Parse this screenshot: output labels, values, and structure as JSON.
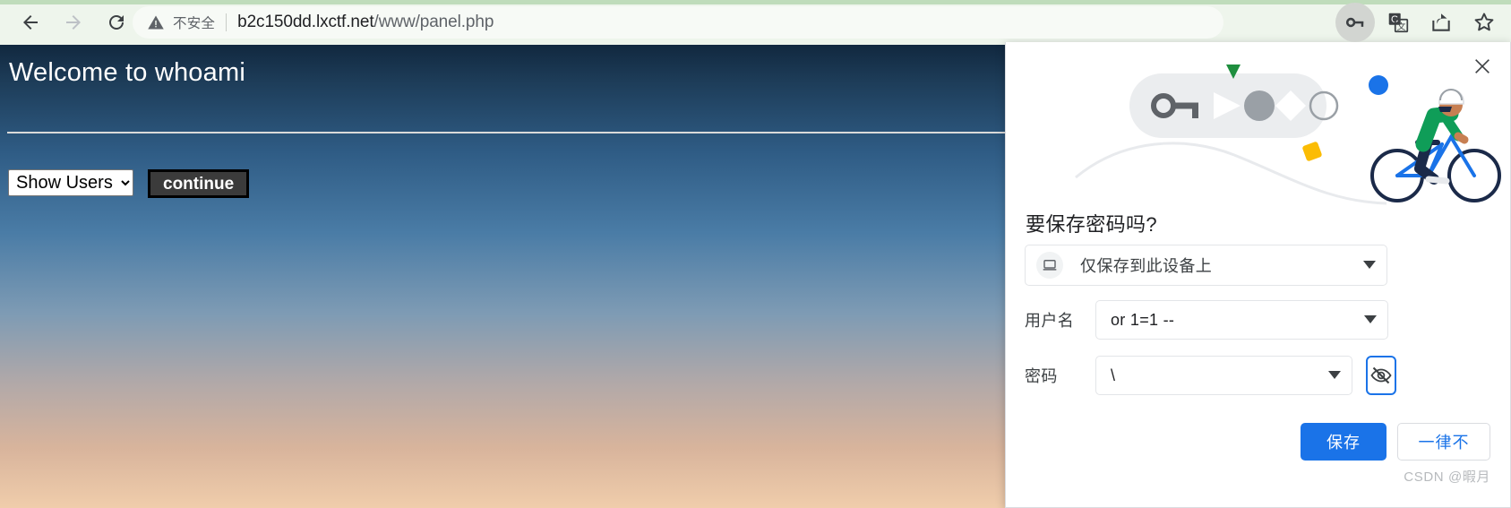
{
  "browser": {
    "nav": {
      "back_label": "Back",
      "forward_label": "Forward",
      "reload_label": "Reload"
    },
    "omnibox": {
      "security_text": "不安全",
      "url_host": "b2c150dd.lxctf.net",
      "url_path": "/www/panel.php",
      "url_full": "b2c150dd.lxctf.net/www/panel.php",
      "warning_icon": "warning-triangle-icon"
    },
    "actions": [
      {
        "name": "password-manager-key-icon",
        "label": "密码管理工具",
        "highlighted": true
      },
      {
        "name": "translate-icon",
        "label": "翻译此网页"
      },
      {
        "name": "share-icon",
        "label": "分享"
      },
      {
        "name": "bookmark-star-icon",
        "label": "收藏此标签页"
      }
    ]
  },
  "page": {
    "heading": "Welcome to whoami",
    "select": {
      "selected": "Show Users",
      "options": [
        "Show Users"
      ]
    },
    "submit_label": "continue"
  },
  "dialog": {
    "close_label": "×",
    "title": "要保存密码吗?",
    "store_option": {
      "icon": "laptop-icon",
      "label": "仅保存到此设备上"
    },
    "username": {
      "label": "用户名",
      "value": "or 1=1 --"
    },
    "password": {
      "label": "密码",
      "value": "\\",
      "toggle_icon": "eye-slash-icon"
    },
    "save_label": "保存",
    "never_label": "一律不",
    "watermark": "CSDN @暇月",
    "colors": {
      "primary": "#1a73e8",
      "text": "#202124",
      "border": "#dadce0"
    }
  }
}
